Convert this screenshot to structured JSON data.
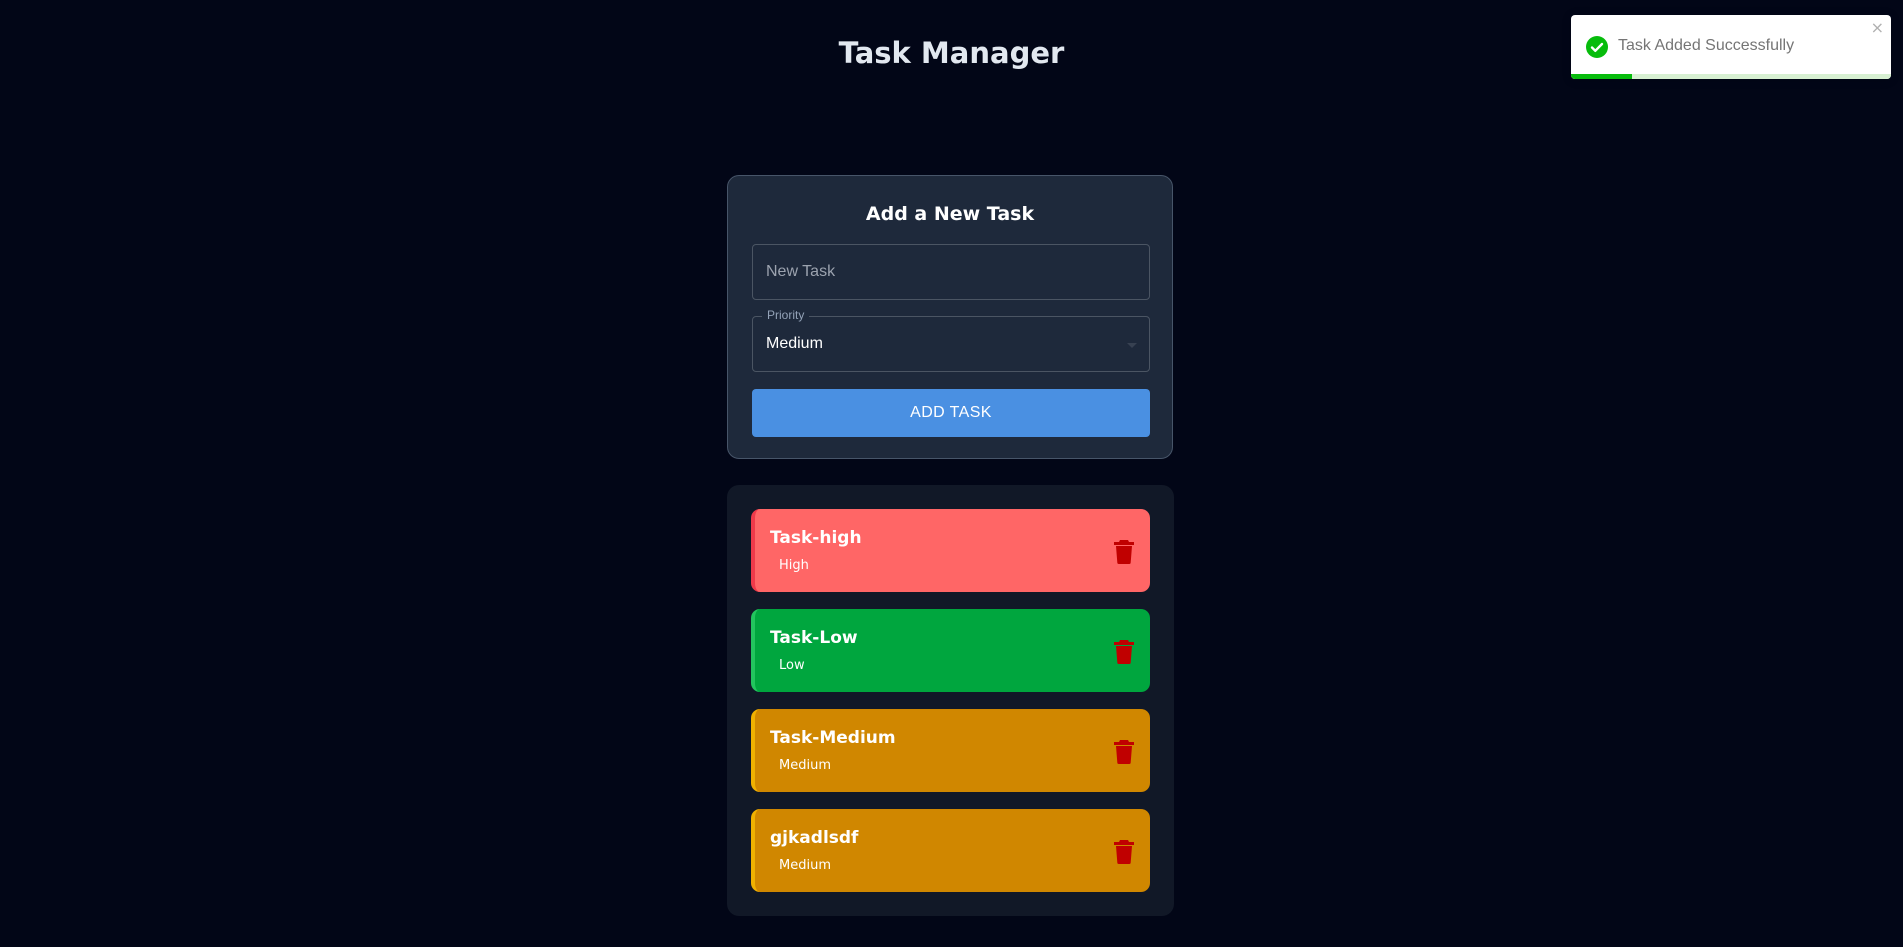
{
  "app": {
    "title": "Task Manager"
  },
  "form": {
    "title": "Add a New Task",
    "task_placeholder": "New Task",
    "priority_label": "Priority",
    "priority_value": "Medium",
    "add_button_label": "ADD TASK"
  },
  "tasks": [
    {
      "name": "Task-high",
      "priority": "High",
      "bg_color": "#ff6666",
      "accent_color": "#ef3a4a"
    },
    {
      "name": "Task-Low",
      "priority": "Low",
      "bg_color": "#00a63e",
      "accent_color": "#22c55e"
    },
    {
      "name": "Task-Medium",
      "priority": "Medium",
      "bg_color": "#d08700",
      "accent_color": "#f0b100"
    },
    {
      "name": "gjkadlsdf",
      "priority": "Medium",
      "bg_color": "#d08700",
      "accent_color": "#f0b100"
    }
  ],
  "icons": {
    "delete": "trash-icon",
    "delete_color": "#c00000",
    "toast_success": "check-circle-icon",
    "toast_close": "close-icon"
  },
  "toast": {
    "message": "Task Added Successfully",
    "close_glyph": "×",
    "progress": 0.19,
    "success_color": "#07bc0c"
  },
  "colors": {
    "background": "#020617",
    "card": "#1e293b",
    "button": "#4a90e2"
  }
}
